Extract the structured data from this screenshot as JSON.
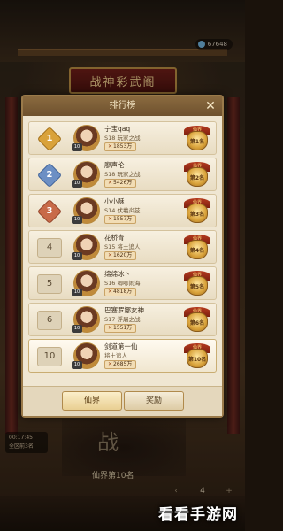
{
  "background": {
    "counter_value": "67648",
    "plaque_title": "战神彩武阁",
    "side_info": [
      "00:17:45",
      "全区前3名"
    ],
    "bottom_big_text": "战",
    "bottom_subtitle": "仙界第10名",
    "stepper": {
      "minus": "‹",
      "value": "4",
      "plus": "+"
    },
    "watermark": "看看手游网"
  },
  "modal": {
    "title": "排行榜",
    "close_label": "✕",
    "rows": [
      {
        "rank": "1",
        "rank_color": "#d9a23a",
        "name": "宁宝qaq",
        "server": "S18 玩家之战",
        "power": "1853万",
        "medal_top": "仙界",
        "medal_rank": "第1名",
        "level": "10"
      },
      {
        "rank": "2",
        "rank_color": "#6c8fc4",
        "name": "廖声伦",
        "server": "S18 玩家之战",
        "power": "5426万",
        "medal_top": "仙界",
        "medal_rank": "第2名",
        "level": "10"
      },
      {
        "rank": "3",
        "rank_color": "#c86a48",
        "name": "小小酥",
        "server": "S14 伏羲炎兹",
        "power": "1557万",
        "medal_top": "仙界",
        "medal_rank": "第3名",
        "level": "10"
      },
      {
        "rank": "4",
        "rank_color": "",
        "name": "花桥青",
        "server": "S15 将土追人",
        "power": "1620万",
        "medal_top": "仙界",
        "medal_rank": "第4名",
        "level": "10"
      },
      {
        "rank": "5",
        "rank_color": "",
        "name": "绵绵冰丶",
        "server": "S16 唧唧闹海",
        "power": "4818万",
        "medal_top": "仙界",
        "medal_rank": "第5名",
        "level": "10"
      },
      {
        "rank": "6",
        "rank_color": "",
        "name": "巴塞罗娜女神",
        "server": "S17 浮屠之战",
        "power": "1551万",
        "medal_top": "仙界",
        "medal_rank": "第6名",
        "level": "10"
      },
      {
        "rank": "10",
        "rank_color": "",
        "name": "剑道第一仙",
        "server": "将土追人",
        "power": "2685万",
        "medal_top": "仙界",
        "medal_rank": "第10名",
        "level": "10"
      }
    ],
    "footer": {
      "tab_realm": "仙界",
      "tab_reward": "奖励"
    }
  }
}
